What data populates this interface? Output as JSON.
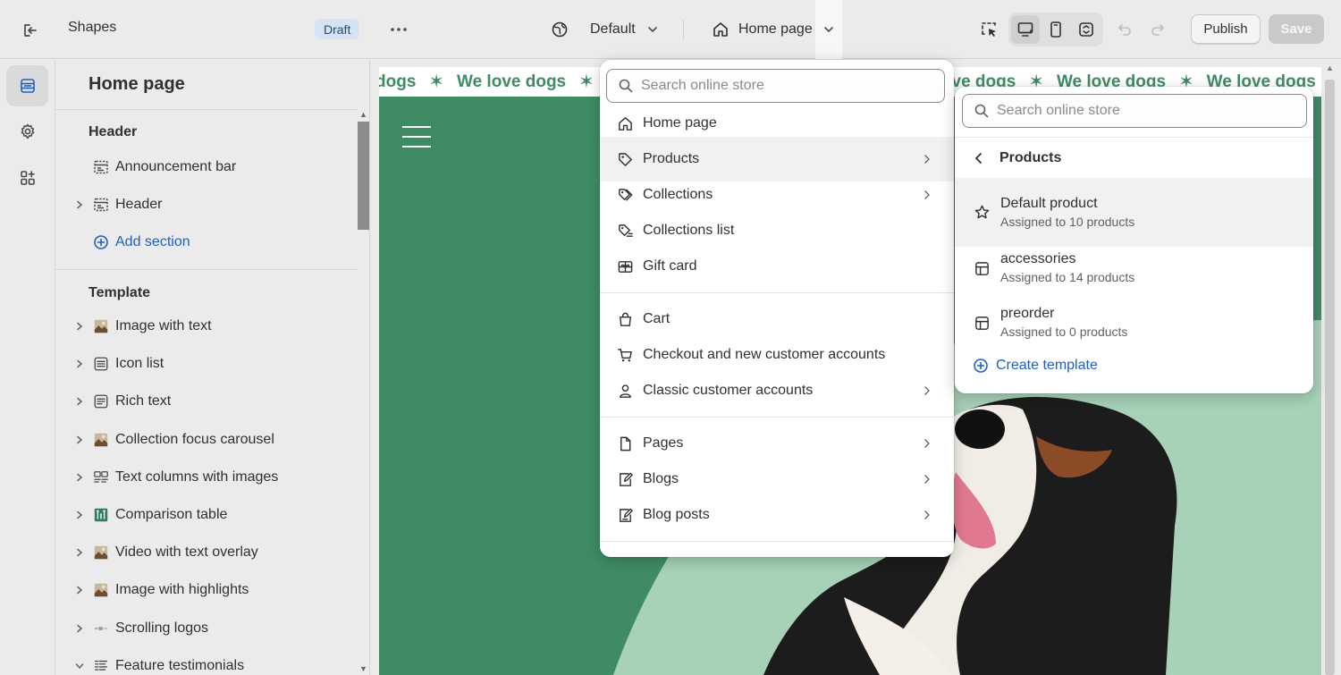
{
  "topbar": {
    "store_name": "Shapes",
    "status_badge": "Draft",
    "theme_selector": "Default",
    "page_selector": "Home page",
    "publish_label": "Publish",
    "save_label": "Save"
  },
  "sidebar": {
    "title": "Home page",
    "header_group": {
      "heading": "Header",
      "items": [
        {
          "label": "Announcement bar",
          "icon": "section-icon"
        },
        {
          "label": "Header",
          "icon": "section-icon"
        }
      ],
      "add_section": "Add section"
    },
    "template_group": {
      "heading": "Template",
      "items": [
        {
          "label": "Image with text",
          "icon": "image-thumb-icon"
        },
        {
          "label": "Icon list",
          "icon": "list-icon"
        },
        {
          "label": "Rich text",
          "icon": "text-icon"
        },
        {
          "label": "Collection focus carousel",
          "icon": "image-thumb-icon"
        },
        {
          "label": "Text columns with images",
          "icon": "columns-icon"
        },
        {
          "label": "Comparison table",
          "icon": "table-icon"
        },
        {
          "label": "Video with text overlay",
          "icon": "image-thumb-icon"
        },
        {
          "label": "Image with highlights",
          "icon": "image-thumb-icon"
        },
        {
          "label": "Scrolling logos",
          "icon": "logos-icon"
        },
        {
          "label": "Feature testimonials",
          "icon": "testimonials-icon"
        }
      ]
    }
  },
  "preview": {
    "marquee_text": "We love dogs",
    "marquee_first": "dogs",
    "marquee_last": "W",
    "colors": {
      "brand_green": "#3f8c64",
      "mint": "#a7d2b8"
    }
  },
  "page_menu": {
    "search_placeholder": "Search online store",
    "items": [
      {
        "label": "Home page",
        "icon": "home-icon",
        "submenu": false
      },
      {
        "label": "Products",
        "icon": "tag-icon",
        "submenu": true,
        "highlighted": true
      },
      {
        "label": "Collections",
        "icon": "tags-icon",
        "submenu": true
      },
      {
        "label": "Collections list",
        "icon": "tags-list-icon",
        "submenu": false
      },
      {
        "label": "Gift card",
        "icon": "gift-card-icon",
        "submenu": false
      },
      {
        "label": "Cart",
        "icon": "bag-icon",
        "submenu": false
      },
      {
        "label": "Checkout and new customer accounts",
        "icon": "cart-icon",
        "submenu": false
      },
      {
        "label": "Classic customer accounts",
        "icon": "person-icon",
        "submenu": true
      },
      {
        "label": "Pages",
        "icon": "page-icon",
        "submenu": true
      },
      {
        "label": "Blogs",
        "icon": "blog-icon",
        "submenu": true
      },
      {
        "label": "Blog posts",
        "icon": "blog-post-icon",
        "submenu": true
      }
    ]
  },
  "products_menu": {
    "search_placeholder": "Search online store",
    "title": "Products",
    "templates": [
      {
        "name": "Default product",
        "assigned": "Assigned to 10 products",
        "icon": "star-icon",
        "highlighted": true
      },
      {
        "name": "accessories",
        "assigned": "Assigned to 14 products",
        "icon": "template-icon"
      },
      {
        "name": "preorder",
        "assigned": "Assigned to 0 products",
        "icon": "template-icon"
      }
    ],
    "create_label": "Create template"
  }
}
